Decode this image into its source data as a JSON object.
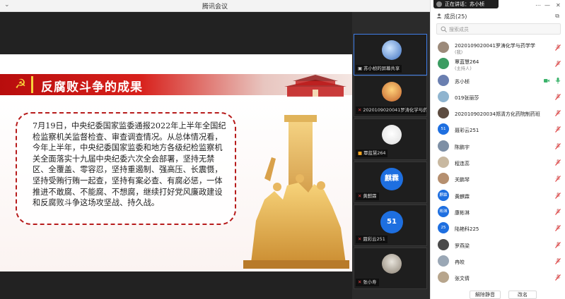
{
  "app": {
    "title": "腾讯会议"
  },
  "speaking": {
    "label": "正在讲话：苏小桢"
  },
  "slide": {
    "title": "反腐败斗争的成果",
    "body": "7月19日，中央纪委国家监委通报2022年上半年全国纪检监察机关监督检查、审查调查情况。从总体情况看，今年上半年，中央纪委国家监委和地方各级纪检监察机关全面落实十九届中央纪委六次全会部署，坚持无禁区、全覆盖、零容忍，坚持重遏制、强高压、长震慑，坚持受贿行贿一起查，坚持有案必查、有腐必惩，一体推进不敢腐、不能腐、不想腐，继续打好党风廉政建设和反腐败斗争这场攻坚战、持久战。"
  },
  "tiles": [
    {
      "name": "苏小桢的屏幕共享",
      "avatar": ""
    },
    {
      "name": "2020109020041罗涛化学与药学学",
      "avatar": ""
    },
    {
      "name": "覃蓝慧264",
      "avatar": ""
    },
    {
      "name": "黄麒霖",
      "avatar": "麒霖"
    },
    {
      "name": "聂彩云251",
      "avatar": "51"
    },
    {
      "name": "张小寿",
      "avatar": ""
    }
  ],
  "members": {
    "header": "成员(25)",
    "search_placeholder": "搜索成员",
    "items": [
      {
        "name": "2020109020041罗涛化学与药学学",
        "sub": "(我)",
        "avatar": "",
        "color": "#9c8a7a"
      },
      {
        "name": "覃蓝慧264",
        "sub": "(主持人)",
        "avatar": "",
        "color": "#3b9c62"
      },
      {
        "name": "苏小桢",
        "sub": "",
        "avatar": "",
        "color": "#6a7fb0"
      },
      {
        "name": "019张丽莎",
        "sub": "",
        "avatar": "",
        "color": "#8fb4cf"
      },
      {
        "name": "2020109020034郑清方化药院制药班",
        "sub": "",
        "avatar": "",
        "color": "#5d4c40"
      },
      {
        "name": "聂彩云251",
        "sub": "",
        "avatar": "51",
        "color": "#1e6fe0"
      },
      {
        "name": "陈鹏宇",
        "sub": "",
        "avatar": "",
        "color": "#7d8fa5"
      },
      {
        "name": "程连蕊",
        "sub": "",
        "avatar": "",
        "color": "#c8b8a0"
      },
      {
        "name": "关鹏琴",
        "sub": "",
        "avatar": "",
        "color": "#b58f6f"
      },
      {
        "name": "黄麒霖",
        "sub": "",
        "avatar": "麒霖",
        "color": "#1e6fe0"
      },
      {
        "name": "康彬淋",
        "sub": "",
        "avatar": "彬淋",
        "color": "#1e6fe0"
      },
      {
        "name": "陆艳科225",
        "sub": "",
        "avatar": "25",
        "color": "#1e6fe0"
      },
      {
        "name": "罗燕梁",
        "sub": "",
        "avatar": "",
        "color": "#4a4a4a"
      },
      {
        "name": "冉皎",
        "sub": "",
        "avatar": "",
        "color": "#9aa7b5"
      },
      {
        "name": "张文倩",
        "sub": "",
        "avatar": "",
        "color": "#b7a58c"
      }
    ]
  },
  "footer": {
    "unmute_label": "解除静音",
    "rename_label": "改名"
  },
  "colors": {
    "accent_red": "#c8141a",
    "blue": "#1e6fe0"
  }
}
